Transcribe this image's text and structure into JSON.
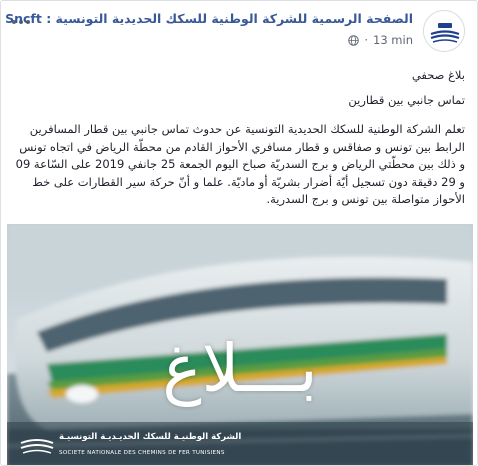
{
  "post": {
    "page_name": "الصفحة الرسمية للشركة الوطنية للسكك الحديدية التونسية : Sncft",
    "time": "13 min",
    "privacy_icon": "globe-icon",
    "more_icon": "more-options-icon",
    "text": {
      "heading": "بلاغ صحفي",
      "subheading": "تماس جانبي بين قطارين",
      "body": "تعلم الشركة الوطنية للسكك الحديدية التونسية عن حدوث تماس جانبي بين قطار المسافرين الرابط بين تونس و صفاقس و قطار مسافري الأحواز القادم من محطّة الرياض في اتجاه تونس و ذلك بين محطّتي الرياض و برج السدريّة صباح اليوم الجمعة 25 جانفي 2019 على السّاعة 09 و 29 دقيقة دون تسجيل أيّة أضرار بشريّة أو ماديّة. علما و أنّ حركة سير القطارات على خط الأحواز متواصلة بين تونس و برج السدرية."
    },
    "image": {
      "caption": "بـــلاغ",
      "logo_ar": "الشركة الوطنيـة للسكك الحديـديـة التونسيـة",
      "logo_fr": "SOCIETE NATIONALE DES CHEMINS DE FER TUNISIENS"
    }
  },
  "colors": {
    "link": "#385898",
    "text": "#1d2129",
    "meta": "#606770",
    "border": "#dddfe2"
  }
}
